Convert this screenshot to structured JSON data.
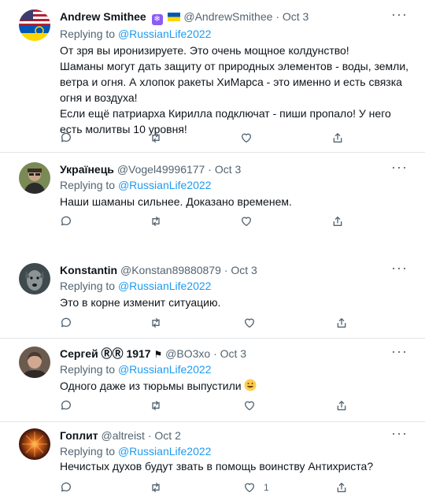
{
  "tweets": [
    {
      "name": "Andrew Smithee",
      "name_icons": [
        "snowflake-icon",
        "ukraine-flag-icon"
      ],
      "handle": "@AndrewSmithee",
      "date": "Oct 3",
      "replying_label": "Replying to",
      "replying_to": "@RussianLife2022",
      "lines": [
        "От зря вы иронизируете. Это очень мощное колдунство!",
        "Шаманы могут дать защиту от природных элементов - воды, земли, ветра и огня. А хлопок ракеты ХиМарса - это именно и есть связка огня и воздуха!",
        "Если ещё патриарха Кирилла подключат - пиши пропало! У него есть молитвы 10 уровня!"
      ],
      "like_count": ""
    },
    {
      "name": "Українець",
      "handle": "@Vogel49996177",
      "date": "Oct 3",
      "replying_label": "Replying to",
      "replying_to": "@RussianLife2022",
      "lines": [
        "Наши шаманы сильнее. Доказано временем."
      ],
      "like_count": ""
    },
    {
      "name": "Konstantin",
      "handle": "@Konstan89880879",
      "date": "Oct 3",
      "replying_label": "Replying to",
      "replying_to": "@RussianLife2022",
      "lines": [
        "Это в корне изменит ситуацию."
      ],
      "like_count": ""
    },
    {
      "name": "Сергей ⓇⓇ 1917",
      "handle": "@BO3xo",
      "date": "Oct 3",
      "replying_label": "Replying to",
      "replying_to": "@RussianLife2022",
      "lines": [
        "Одного даже из тюрьмы выпустили"
      ],
      "like_count": ""
    },
    {
      "name": "Гоплит",
      "handle": "@altreist",
      "date": "Oct 2",
      "replying_label": "Replying to",
      "replying_to": "@RussianLife2022",
      "lines": [
        "Нечистых духов будут звать в помощь воинству Антихриста?"
      ],
      "like_count": "1"
    }
  ],
  "dot": "·",
  "more_label": "···",
  "colors": {
    "link": "#1d9bf0",
    "muted": "#536471",
    "divider": "#e1e6ea"
  }
}
